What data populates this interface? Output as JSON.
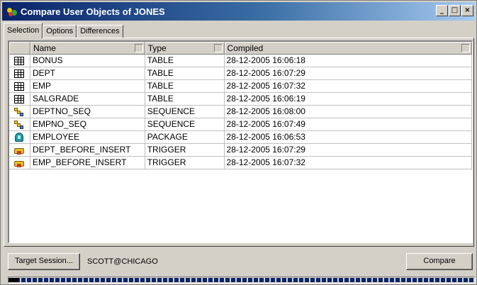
{
  "window": {
    "title": "Compare User Objects of JONES",
    "controls": {
      "minimize": "_",
      "maximize": "□",
      "close": "×"
    }
  },
  "tabs": [
    {
      "label": "Selection",
      "active": true
    },
    {
      "label": "Options",
      "active": false
    },
    {
      "label": "Differences",
      "active": false
    }
  ],
  "grid": {
    "columns": [
      "",
      "Name",
      "Type",
      "Compiled"
    ],
    "rows": [
      {
        "icon": "table-icon",
        "name": "BONUS",
        "type": "TABLE",
        "compiled": "28-12-2005 16:06:18"
      },
      {
        "icon": "table-icon",
        "name": "DEPT",
        "type": "TABLE",
        "compiled": "28-12-2005 16:07:29"
      },
      {
        "icon": "table-icon",
        "name": "EMP",
        "type": "TABLE",
        "compiled": "28-12-2005 16:07:32"
      },
      {
        "icon": "table-icon",
        "name": "SALGRADE",
        "type": "TABLE",
        "compiled": "28-12-2005 16:06:19"
      },
      {
        "icon": "sequence-icon",
        "name": "DEPTNO_SEQ",
        "type": "SEQUENCE",
        "compiled": "28-12-2005 16:08:00"
      },
      {
        "icon": "sequence-icon",
        "name": "EMPNO_SEQ",
        "type": "SEQUENCE",
        "compiled": "28-12-2005 16:07:49"
      },
      {
        "icon": "package-icon",
        "name": "EMPLOYEE",
        "type": "PACKAGE",
        "compiled": "28-12-2005 16:06:53"
      },
      {
        "icon": "trigger-icon",
        "name": "DEPT_BEFORE_INSERT",
        "type": "TRIGGER",
        "compiled": "28-12-2005 16:07:29"
      },
      {
        "icon": "trigger-icon",
        "name": "EMP_BEFORE_INSERT",
        "type": "TRIGGER",
        "compiled": "28-12-2005 16:07:32"
      }
    ],
    "empty_row_count": 8
  },
  "bottom": {
    "target_button": "Target Session...",
    "session": "SCOTT@CHICAGO",
    "compare_button": "Compare"
  },
  "progress": {
    "value": 1.0
  },
  "colors": {
    "title_start": "#0a246a",
    "title_end": "#a6caf0",
    "face": "#d4d0c8",
    "progress": "#0a246a"
  }
}
